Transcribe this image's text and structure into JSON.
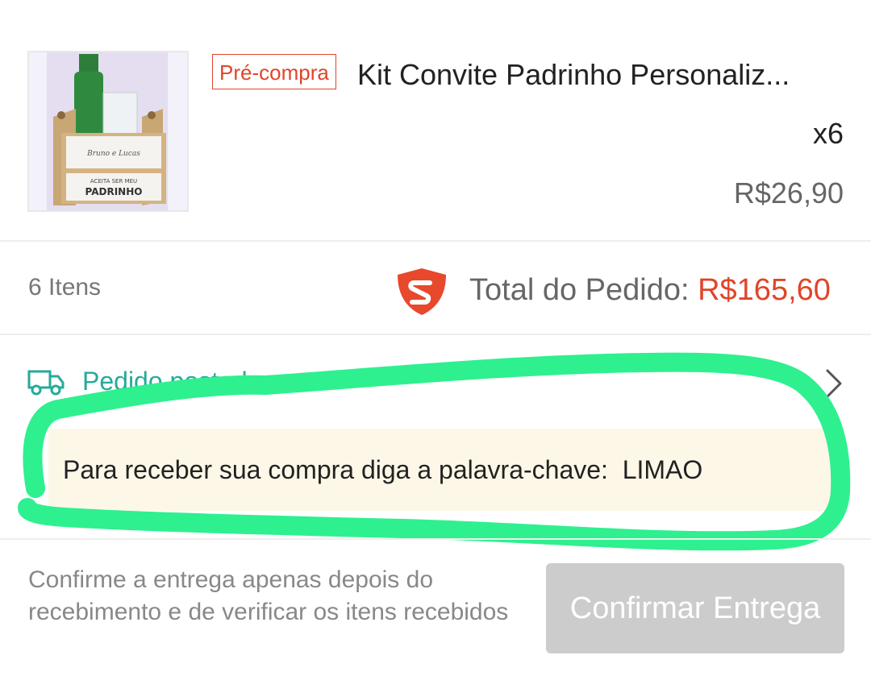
{
  "product": {
    "badge": "Pré-compra",
    "title": "Kit Convite Padrinho Personaliz...",
    "quantity": "x6",
    "price": "R$26,90",
    "image": {
      "icon": "product-photo",
      "mug_text": "Bruno e Lucas",
      "box_line1": "ACEITA SER MEU",
      "box_line2": "PADRINHO"
    }
  },
  "summary": {
    "items": "6 Itens",
    "total_label": "Total do Pedido: ",
    "total_value": "R$165,60",
    "icon": "shield-logo-icon"
  },
  "shipping": {
    "status": "Pedido postado",
    "icon": "truck-icon",
    "notice": "Para receber sua compra diga a palavra-chave:  LIMAO"
  },
  "footer": {
    "note": "Confirme a entrega apenas depois do recebimento e de verificar os itens recebidos",
    "button_label": "Confirmar Entrega"
  },
  "colors": {
    "accent": "#e0452a",
    "status_teal": "#26aa99",
    "notice_bg": "#fdf7e8",
    "highlight_stroke": "#2ef08f",
    "button_disabled": "#cccccc"
  }
}
